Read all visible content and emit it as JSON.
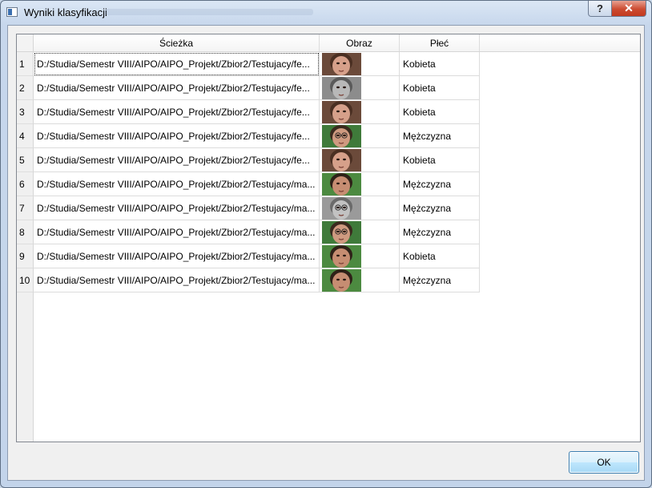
{
  "window": {
    "title": "Wyniki klasyfikacji",
    "help_label": "?",
    "close_label": "✕"
  },
  "table": {
    "headers": {
      "path": "Ścieżka",
      "image": "Obraz",
      "sex": "Płeć"
    },
    "rows": [
      {
        "num": "1",
        "path": "D:/Studia/Semestr VIII/AIPO/AIPO_Projekt/Zbior2/Testujacy/fe...",
        "sex": "Kobieta",
        "face": "female-face-icon"
      },
      {
        "num": "2",
        "path": "D:/Studia/Semestr VIII/AIPO/AIPO_Projekt/Zbior2/Testujacy/fe...",
        "sex": "Kobieta",
        "face": "female-face-gray-icon"
      },
      {
        "num": "3",
        "path": "D:/Studia/Semestr VIII/AIPO/AIPO_Projekt/Zbior2/Testujacy/fe...",
        "sex": "Kobieta",
        "face": "female-face-icon"
      },
      {
        "num": "4",
        "path": "D:/Studia/Semestr VIII/AIPO/AIPO_Projekt/Zbior2/Testujacy/fe...",
        "sex": "Mężczyzna",
        "face": "face-with-glasses-icon"
      },
      {
        "num": "5",
        "path": "D:/Studia/Semestr VIII/AIPO/AIPO_Projekt/Zbior2/Testujacy/fe...",
        "sex": "Kobieta",
        "face": "female-face-icon"
      },
      {
        "num": "6",
        "path": "D:/Studia/Semestr VIII/AIPO/AIPO_Projekt/Zbior2/Testujacy/ma...",
        "sex": "Mężczyzna",
        "face": "male-face-icon"
      },
      {
        "num": "7",
        "path": "D:/Studia/Semestr VIII/AIPO/AIPO_Projekt/Zbior2/Testujacy/ma...",
        "sex": "Mężczyzna",
        "face": "male-face-gray-icon"
      },
      {
        "num": "8",
        "path": "D:/Studia/Semestr VIII/AIPO/AIPO_Projekt/Zbior2/Testujacy/ma...",
        "sex": "Mężczyzna",
        "face": "face-with-glasses-icon"
      },
      {
        "num": "9",
        "path": "D:/Studia/Semestr VIII/AIPO/AIPO_Projekt/Zbior2/Testujacy/ma...",
        "sex": "Kobieta",
        "face": "male-face-icon"
      },
      {
        "num": "10",
        "path": "D:/Studia/Semestr VIII/AIPO/AIPO_Projekt/Zbior2/Testujacy/ma...",
        "sex": "Mężczyzna",
        "face": "male-face-icon"
      }
    ]
  },
  "footer": {
    "ok_label": "OK"
  }
}
